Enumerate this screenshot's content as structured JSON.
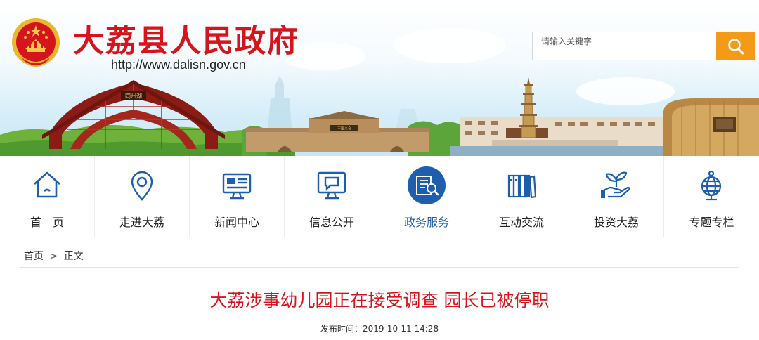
{
  "header": {
    "site_title": "大荔县人民政府",
    "site_url": "http://www.dalisn.gov.cn",
    "search_placeholder": "请输入关键字",
    "gateway_plaque": "同州湖",
    "wall_plaque": "丰图义仓"
  },
  "nav": {
    "items": [
      {
        "label": "首　页",
        "icon": "home-icon",
        "active": false
      },
      {
        "label": "走进大荔",
        "icon": "location-pin-icon",
        "active": false
      },
      {
        "label": "新闻中心",
        "icon": "monitor-news-icon",
        "active": false
      },
      {
        "label": "信息公开",
        "icon": "message-screen-icon",
        "active": false
      },
      {
        "label": "政务服务",
        "icon": "document-search-icon",
        "active": true
      },
      {
        "label": "互动交流",
        "icon": "books-icon",
        "active": false
      },
      {
        "label": "投资大荔",
        "icon": "hand-plant-icon",
        "active": false
      },
      {
        "label": "专题专栏",
        "icon": "globe-icon",
        "active": false
      }
    ]
  },
  "breadcrumb": {
    "home": "首页",
    "separator": ">",
    "current": "正文"
  },
  "article": {
    "title": "大荔涉事幼儿园正在接受调查 园长已被停职",
    "publish_label": "发布时间：",
    "publish_time": "2019-10-11 14:28"
  },
  "colors": {
    "title_red": "#d6141b",
    "search_orange": "#f39a17",
    "nav_blue": "#1d5fae"
  }
}
